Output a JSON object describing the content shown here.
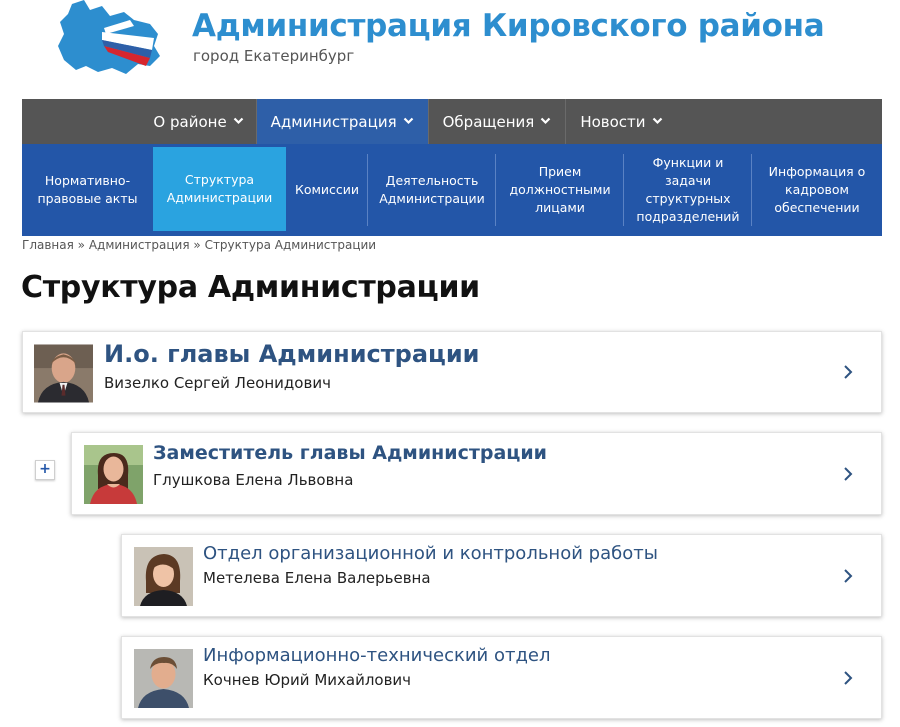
{
  "header": {
    "title": "Администрация Кировского района",
    "subtitle": "город Екатеринбург"
  },
  "topnav": {
    "items": [
      {
        "label": "О районе",
        "icon": "chevron-down-icon"
      },
      {
        "label": "Администрация",
        "icon": "chevron-down-icon",
        "active": true
      },
      {
        "label": "Обращения",
        "icon": "chevron-down-icon"
      },
      {
        "label": "Новости",
        "icon": "chevron-down-icon"
      }
    ]
  },
  "subnav": {
    "items": [
      {
        "label": "Нормативно-правовые акты"
      },
      {
        "label": "Структура Администрации",
        "active": true
      },
      {
        "label": "Комиссии"
      },
      {
        "label": "Деятельность Администрации"
      },
      {
        "label": "Прием должностными лицами"
      },
      {
        "label": "Функции и задачи структурных подразделений"
      },
      {
        "label": "Информация о кадровом обеспечении"
      }
    ]
  },
  "breadcrumb": {
    "home": "Главная",
    "sep1": " » ",
    "section": "Администрация",
    "sep2": " » ",
    "current": "Структура Администрации"
  },
  "page": {
    "title": "Структура Администрации"
  },
  "cards": [
    {
      "title": "И.о. главы Администрации",
      "name": "Визелко Сергей Леонидович"
    },
    {
      "title": "Заместитель главы Администрации",
      "name": "Глушкова Елена Львовна"
    },
    {
      "title": "Отдел организационной и контрольной работы",
      "name": "Метелева Елена Валерьевна"
    },
    {
      "title": "Информационно-технический отдел",
      "name": "Кочнев Юрий Михайлович"
    }
  ],
  "expand_button": {
    "label": "+"
  },
  "colors": {
    "brand_blue": "#2d8ecf",
    "nav_gray": "#555555",
    "nav_active": "#2e5fa8",
    "subnav_blue": "#2356a8",
    "subnav_active": "#2aa3e0",
    "card_title": "#2e5381"
  }
}
